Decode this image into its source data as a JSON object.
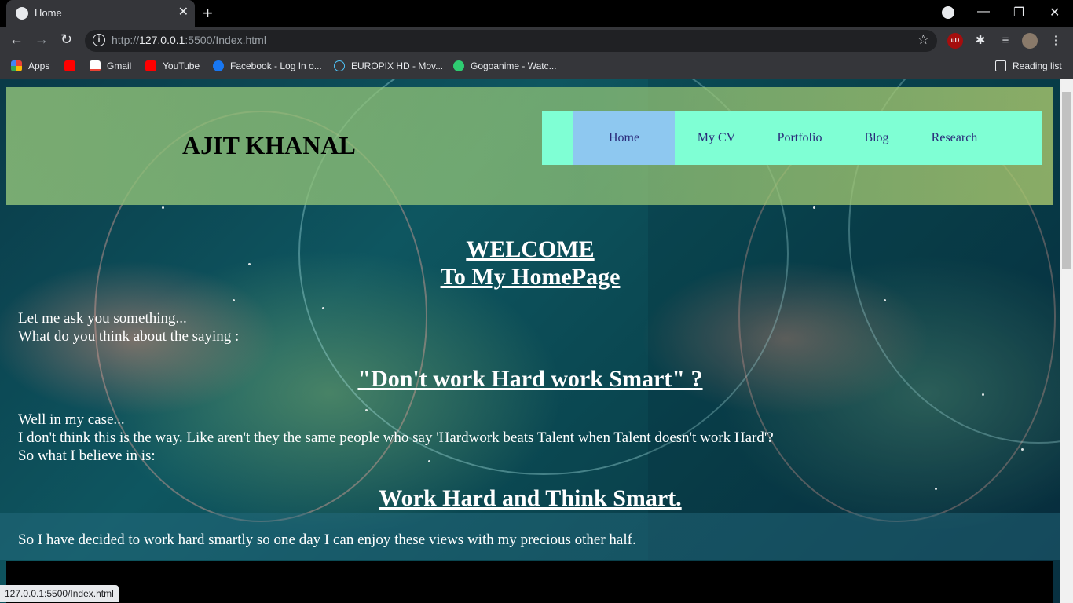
{
  "browser": {
    "tab_title": "Home",
    "url_host": "127.0.0.1",
    "url_prefix": "http://",
    "url_rest": ":5500/Index.html",
    "reading_list": "Reading list",
    "status_url": "127.0.0.1:5500/Index.html"
  },
  "bookmarks": [
    {
      "label": "Apps",
      "color": "#ea4335"
    },
    {
      "label": "",
      "color": "#ff0000"
    },
    {
      "label": "Gmail",
      "color": "#ea4335"
    },
    {
      "label": "YouTube",
      "color": "#ff0000"
    },
    {
      "label": "Facebook - Log In o...",
      "color": "#1877f2"
    },
    {
      "label": "EUROPIX HD - Mov...",
      "color": "#4fc3f7"
    },
    {
      "label": "Gogoanime - Watc...",
      "color": "#2ecc71"
    }
  ],
  "site": {
    "logo": "AJIT KHANAL",
    "nav": [
      "Home",
      "My CV",
      "Portfolio",
      "Blog",
      "Research"
    ],
    "welcome_line1": "WELCOME",
    "welcome_line2": "To My HomePage",
    "intro_line1": "Let me ask you something...",
    "intro_line2": "What do you think about the saying :",
    "quote": "\"Don't work Hard work Smart\" ?",
    "case_line1": "Well in my case...",
    "case_line2": "I don't think this is the way. Like aren't they the same people who say 'Hardwork beats Talent when Talent doesn't work Hard'?",
    "case_line3": "So what I believe in is:",
    "motto": "Work Hard and Think Smart.",
    "closing": "So I have decided to work hard smartly so one day I can enjoy these views with my precious other half."
  },
  "colors": {
    "nav_bg": "#7fffd4",
    "nav_active": "#8ec8f0",
    "nav_text": "#2a2a7a"
  }
}
